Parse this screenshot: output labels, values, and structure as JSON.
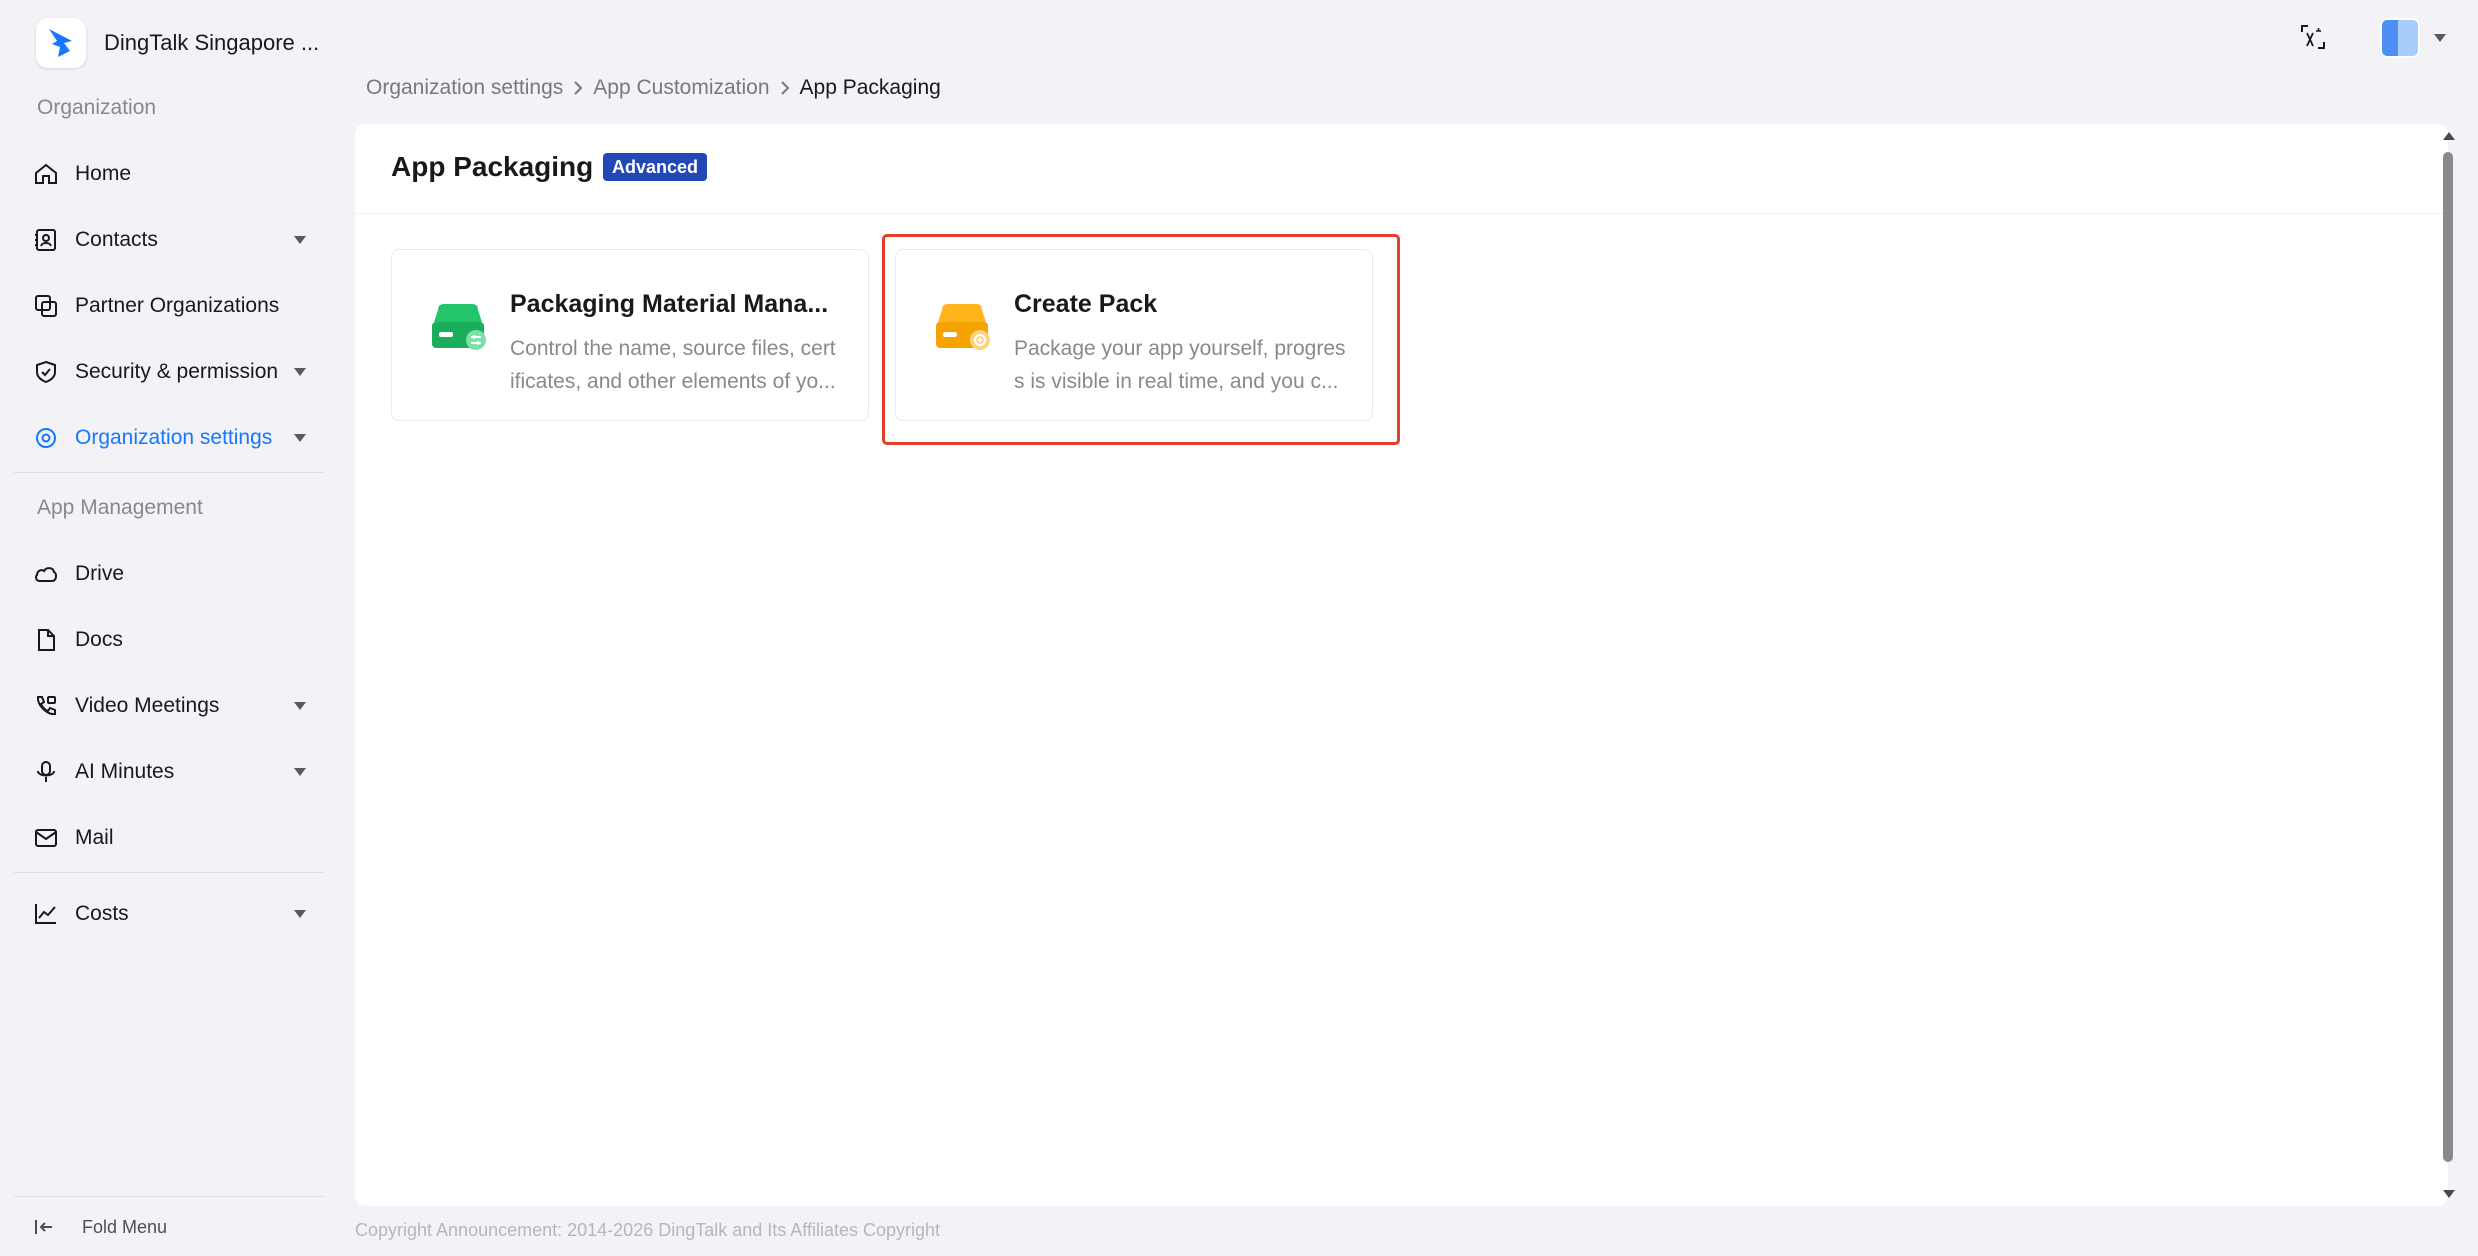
{
  "brand": {
    "name": "DingTalk Singapore ..."
  },
  "sidebar": {
    "section_organization": "Organization",
    "section_app_management": "App Management",
    "items": [
      {
        "label": "Home",
        "icon": "home-icon",
        "has_caret": false
      },
      {
        "label": "Contacts",
        "icon": "contacts-icon",
        "has_caret": true
      },
      {
        "label": "Partner Organizations",
        "icon": "partner-icon",
        "has_caret": false
      },
      {
        "label": "Security & permission",
        "icon": "shield-icon",
        "has_caret": true
      },
      {
        "label": "Organization settings",
        "icon": "settings-icon",
        "has_caret": true,
        "active": true
      }
    ],
    "app_items": [
      {
        "label": "Drive",
        "icon": "cloud-icon",
        "has_caret": false
      },
      {
        "label": "Docs",
        "icon": "doc-icon",
        "has_caret": false
      },
      {
        "label": "Video Meetings",
        "icon": "phone-video-icon",
        "has_caret": true
      },
      {
        "label": "AI Minutes",
        "icon": "microphone-icon",
        "has_caret": true
      },
      {
        "label": "Mail",
        "icon": "mail-icon",
        "has_caret": false
      }
    ],
    "costs_item": {
      "label": "Costs",
      "icon": "chart-line-icon",
      "has_caret": true
    },
    "fold_label": "Fold Menu"
  },
  "breadcrumb": [
    "Organization settings",
    "App Customization",
    "App Packaging"
  ],
  "page": {
    "title": "App Packaging",
    "badge": "Advanced"
  },
  "cards": [
    {
      "title": "Packaging Material Mana...",
      "description": "Control the name, source files, cert ificates, and other elements of yo...",
      "icon": "green-drive-settings-icon"
    },
    {
      "title": "Create Pack",
      "description": "Package your app yourself, progres s is visible in real time, and you c...",
      "icon": "orange-drive-add-icon",
      "highlighted": true
    }
  ],
  "footer": "Copyright Announcement: 2014-2026 DingTalk and Its Affiliates Copyright",
  "colors": {
    "accent": "#1677ff",
    "badge_bg": "#2347b7",
    "highlight_border": "#e2402b",
    "green_icon": "#1fbf63",
    "orange_icon": "#f7a800"
  }
}
